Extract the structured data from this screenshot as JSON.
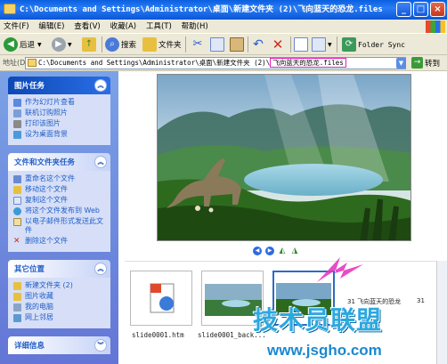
{
  "window": {
    "title": "C:\\Documents and Settings\\Administrator\\桌面\\新建文件夹 (2)\\飞向蓝天的恐龙.files",
    "minimize": "_",
    "maximize": "□",
    "close": "×"
  },
  "menu": [
    "文件(F)",
    "编辑(E)",
    "查看(V)",
    "收藏(A)",
    "工具(T)",
    "帮助(H)"
  ],
  "toolbar": {
    "back": "后退",
    "search": "搜索",
    "folders": "文件夹",
    "folder_sync": "Folder Sync"
  },
  "address": {
    "label": "地址(D)",
    "path_prefix": "C:\\Documents and Settings\\Administrator\\桌面\\新建文件夹 (2)\\",
    "path_highlight": "飞向蓝天的恐龙.files",
    "go": "转到"
  },
  "sidebar": {
    "picture_tasks": {
      "title": "图片任务",
      "items": [
        "作为幻灯片查看",
        "联机订购照片",
        "打印该图片",
        "设为桌面背景"
      ]
    },
    "file_tasks": {
      "title": "文件和文件夹任务",
      "items": [
        "重命名这个文件",
        "移动这个文件",
        "复制这个文件",
        "将这个文件发布到 Web",
        "以电子邮件形式发送此文件",
        "删除这个文件"
      ]
    },
    "other_places": {
      "title": "其它位置",
      "items": [
        "新建文件夹 (2)",
        "图片收藏",
        "我的电脑",
        "网上邻居"
      ]
    },
    "details": {
      "title": "详细信息"
    }
  },
  "filmstrip": {
    "items": [
      {
        "label": "slide0001.htm"
      },
      {
        "label": "slide0001_back..."
      },
      {
        "label": ""
      },
      {
        "label": "31 飞向蓝天的恐龙"
      },
      {
        "label": "31"
      }
    ]
  },
  "watermark": {
    "text": "技术员联盟",
    "url": "www.jsgho.com"
  },
  "colors": {
    "title_bar": "#0b56d6",
    "sidebar_bg": "#6e8bde",
    "highlight_box": "#e020c0",
    "watermark": "#2aa8e0"
  }
}
